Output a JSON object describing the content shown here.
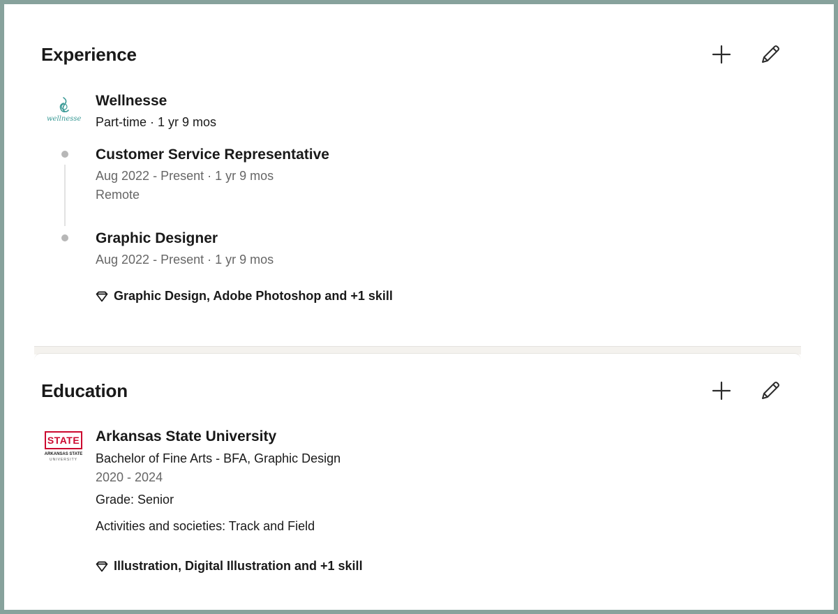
{
  "experience": {
    "title": "Experience",
    "company": {
      "name": "Wellnesse",
      "logo_text": "wellnesse",
      "meta": "Part-time · 1 yr 9 mos"
    },
    "roles": [
      {
        "title": "Customer Service Representative",
        "dates": "Aug 2022 - Present · 1 yr 9 mos",
        "location": "Remote"
      },
      {
        "title": "Graphic Designer",
        "dates": "Aug 2022 - Present · 1 yr 9 mos",
        "skills": "Graphic Design, Adobe Photoshop and +1 skill"
      }
    ]
  },
  "education": {
    "title": "Education",
    "school": {
      "name": "Arkansas State University",
      "logo_text_top": "STATE",
      "logo_text_mid": "ARKANSAS STATE",
      "logo_text_bot": "UNIVERSITY",
      "degree": "Bachelor of Fine Arts - BFA, Graphic Design",
      "years": "2020 - 2024",
      "grade": "Grade: Senior",
      "activities": "Activities and societies: Track and Field",
      "skills": "Illustration, Digital Illustration and +1 skill"
    }
  },
  "icons": {
    "add": "plus-icon",
    "edit": "pencil-icon",
    "skill": "diamond-icon"
  },
  "colors": {
    "frame": "#87a29c",
    "wellnesse_teal": "#3a9a96",
    "astate_red": "#cc092f"
  }
}
